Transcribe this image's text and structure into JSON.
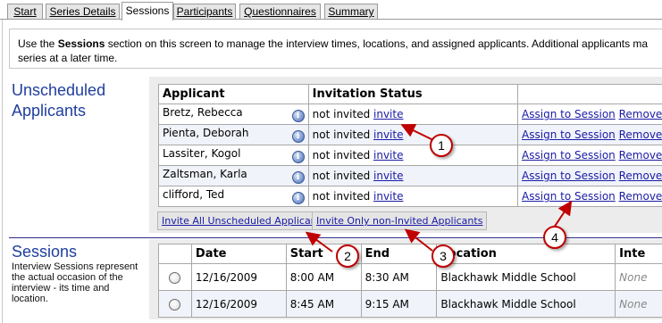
{
  "tabs": [
    {
      "label": "Start"
    },
    {
      "label": "Series Details"
    },
    {
      "label": "Sessions"
    },
    {
      "label": "Participants"
    },
    {
      "label": "Questionnaires"
    },
    {
      "label": "Summary"
    }
  ],
  "active_tab": "Sessions",
  "intro": {
    "prefix": "Use the ",
    "bold": "Sessions",
    "suffix": " section on this screen to manage the interview times, locations, and assigned applicants. Additional applicants ma",
    "line2": "series at a later time."
  },
  "unscheduled": {
    "title_line1": "Unscheduled",
    "title_line2": "Applicants",
    "columns": {
      "applicant": "Applicant",
      "status": "Invitation Status",
      "actions": ""
    },
    "rows": [
      {
        "name": "Bretz, Rebecca",
        "status": "not invited",
        "invite": "invite",
        "assign": "Assign to Session",
        "remove": "Remove"
      },
      {
        "name": "Pienta, Deborah",
        "status": "not invited",
        "invite": "invite",
        "assign": "Assign to Session",
        "remove": "Remove"
      },
      {
        "name": "Lassiter, Kogol",
        "status": "not invited",
        "invite": "invite",
        "assign": "Assign to Session",
        "remove": "Remove"
      },
      {
        "name": "Zaltsman, Karla",
        "status": "not invited",
        "invite": "invite",
        "assign": "Assign to Session",
        "remove": "Remove"
      },
      {
        "name": "clifford, Ted",
        "status": "not invited",
        "invite": "invite",
        "assign": "Assign to Session",
        "remove": "Remove"
      }
    ],
    "invite_all_label": "Invite All Unscheduled Applicants",
    "invite_non_invited_label": "Invite Only non-Invited Applicants"
  },
  "sessions": {
    "title": "Sessions",
    "description": "Interview Sessions represent the actual occasion of the interview - its time and location.",
    "columns": {
      "date": "Date",
      "start": "Start",
      "end": "End",
      "location": "Location",
      "interviewers": "Inte"
    },
    "rows": [
      {
        "date": "12/16/2009",
        "start": "8:00 AM",
        "end": "8:30 AM",
        "location": "Blackhawk Middle School",
        "interviewers": "None"
      },
      {
        "date": "12/16/2009",
        "start": "8:45 AM",
        "end": "9:15 AM",
        "location": "Blackhawk Middle School",
        "interviewers": "None"
      }
    ]
  },
  "callouts": [
    "1",
    "2",
    "3",
    "4"
  ],
  "colors": {
    "accent": "#1f3f9f",
    "link": "#1a1aa6",
    "callout": "#c00000"
  }
}
